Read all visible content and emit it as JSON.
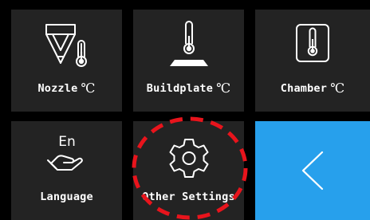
{
  "menu": {
    "nozzle": {
      "label": "Nozzle",
      "unit": "℃",
      "icon": "nozzle-thermometer-icon"
    },
    "buildplate": {
      "label": "Buildplate",
      "unit": "℃",
      "icon": "buildplate-thermometer-icon"
    },
    "chamber": {
      "label": "Chamber",
      "unit": "℃",
      "icon": "chamber-thermometer-icon"
    },
    "language": {
      "label": "Language",
      "icon_text": "En",
      "icon": "language-hand-icon"
    },
    "other_settings": {
      "label": "Other Settings",
      "icon": "gear-icon"
    },
    "back": {
      "icon": "chevron-left-icon"
    }
  },
  "annotation": {
    "shape": "dashed-circle",
    "color": "#e8141c"
  },
  "colors": {
    "tile_background": "#232323",
    "screen_background": "#000000",
    "back_tile": "#27a0ec",
    "text": "#ffffff"
  }
}
